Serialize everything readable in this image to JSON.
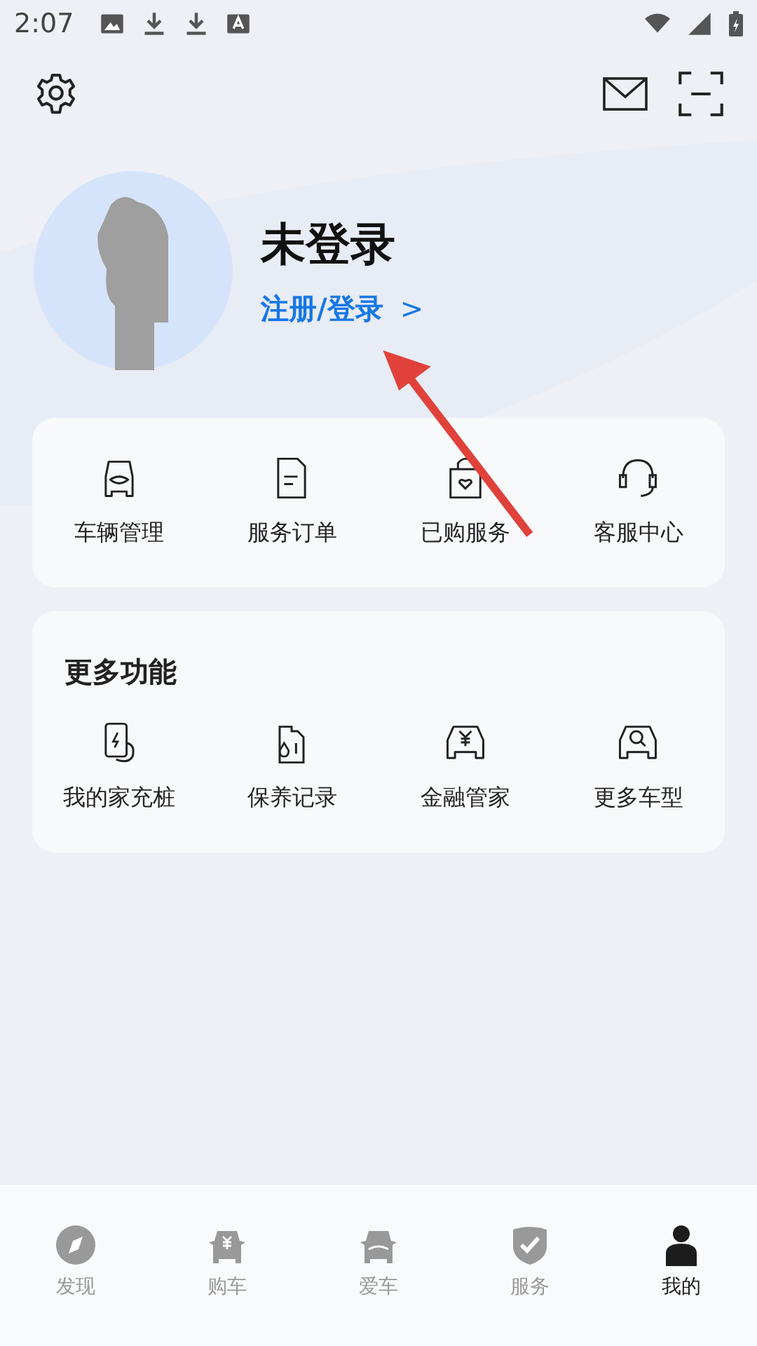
{
  "status_bar": {
    "time": "2:07"
  },
  "profile": {
    "name": "未登录",
    "login_link": "注册/登录",
    "link_arrow": ">"
  },
  "shortcuts": [
    {
      "kind": "car",
      "label": "车辆管理"
    },
    {
      "kind": "document",
      "label": "服务订单"
    },
    {
      "kind": "bag",
      "label": "已购服务"
    },
    {
      "kind": "headset",
      "label": "客服中心"
    }
  ],
  "more_functions": {
    "title": "更多功能",
    "items": [
      {
        "kind": "charger",
        "label": "我的家充桩"
      },
      {
        "kind": "oil",
        "label": "保养记录"
      },
      {
        "kind": "car-yen",
        "label": "金融管家"
      },
      {
        "kind": "car-search",
        "label": "更多车型"
      }
    ]
  },
  "bottom_nav": [
    {
      "kind": "compass",
      "label": "发现",
      "selected": false
    },
    {
      "kind": "car-yen",
      "label": "购车",
      "selected": false
    },
    {
      "kind": "car",
      "label": "爱车",
      "selected": false
    },
    {
      "kind": "shield",
      "label": "服务",
      "selected": false
    },
    {
      "kind": "person",
      "label": "我的",
      "selected": true
    }
  ]
}
